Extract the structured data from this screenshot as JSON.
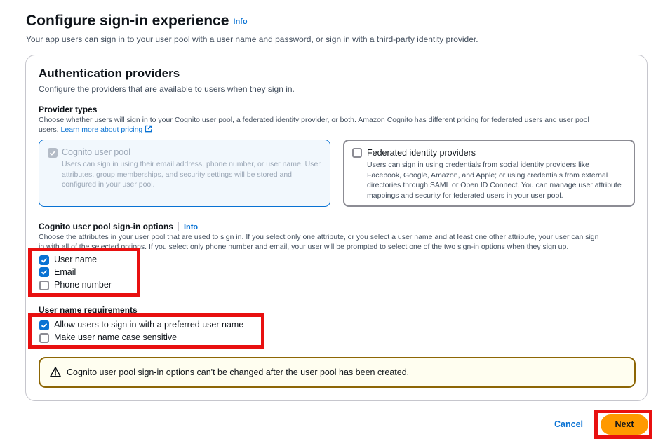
{
  "page": {
    "title": "Configure sign-in experience",
    "info": "Info",
    "description": "Your app users can sign in to your user pool with a user name and password, or sign in with a third-party identity provider."
  },
  "auth": {
    "title": "Authentication providers",
    "description": "Configure the providers that are available to users when they sign in.",
    "provider_types": {
      "label": "Provider types",
      "desc_line1": "Choose whether users will sign in to your Cognito user pool, a federated identity provider, or both. Amazon Cognito has different pricing for federated users and user pool",
      "desc_line2": "users.",
      "learn_more": "Learn more about pricing"
    },
    "tiles": {
      "cognito": {
        "title": "Cognito user pool",
        "description": "Users can sign in using their email address, phone number, or user name. User attributes, group memberships, and security settings will be stored and configured in your user pool."
      },
      "federated": {
        "title": "Federated identity providers",
        "description": "Users can sign in using credentials from social identity providers like Facebook, Google, Amazon, and Apple; or using credentials from external directories through SAML or Open ID Connect. You can manage user attribute mappings and security for federated users in your user pool."
      }
    },
    "signin_options": {
      "label": "Cognito user pool sign-in options",
      "info": "Info",
      "desc_line1": "Choose the attributes in your user pool that are used to sign in. If you select only one attribute, or you select a user name and at least one other attribute, your user can sign",
      "desc_line2": "in with all of the selected options. If you select only phone number and email, your user will be prompted to select one of the two sign-in options when they sign up.",
      "options": [
        "User name",
        "Email",
        "Phone number"
      ]
    },
    "username_req": {
      "label": "User name requirements",
      "options": [
        "Allow users to sign in with a preferred user name",
        "Make user name case sensitive"
      ]
    },
    "alert": "Cognito user pool sign-in options can't be changed after the user pool has been created."
  },
  "footer": {
    "cancel": "Cancel",
    "next": "Next"
  },
  "colors": {
    "accent": "#0972d3",
    "primary_button": "#ff9900",
    "highlight": "#e81010",
    "warning_border": "#8d6605"
  },
  "icons": [
    "external-link-icon",
    "checkmark-icon",
    "warning-icon"
  ]
}
